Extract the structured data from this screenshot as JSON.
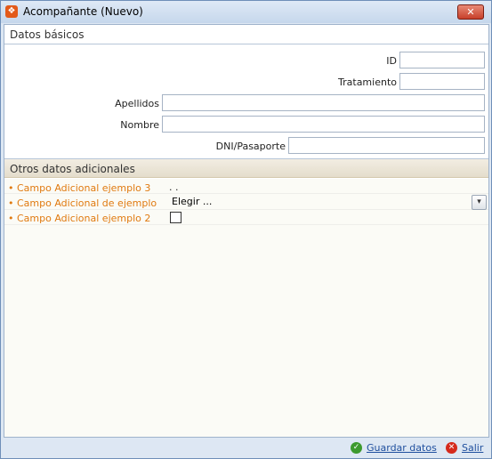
{
  "window": {
    "title": "Acompañante (Nuevo)",
    "close_glyph": "✕",
    "app_icon": "app-logo-icon"
  },
  "basic": {
    "header": "Datos básicos",
    "fields": {
      "id": {
        "label": "ID",
        "value": ""
      },
      "tratamiento": {
        "label": "Tratamiento",
        "value": ""
      },
      "apellidos": {
        "label": "Apellidos",
        "value": ""
      },
      "nombre": {
        "label": "Nombre",
        "value": ""
      },
      "dni": {
        "label": "DNI/Pasaporte",
        "value": ""
      }
    }
  },
  "extra": {
    "header": "Otros datos adicionales",
    "items": [
      {
        "label": "• Campo Adicional ejemplo 3",
        "value": ". ."
      },
      {
        "label": "• Campo Adicional de ejemplo",
        "select_value": "Elegir ..."
      },
      {
        "label": "• Campo Adicional ejemplo 2",
        "checked": false
      }
    ]
  },
  "footer": {
    "save_label": "Guardar datos",
    "exit_label": "Salir"
  },
  "colors": {
    "label_accent": "#e07a10",
    "link": "#1f4f9e",
    "section_tan": "#e4ddcc"
  }
}
